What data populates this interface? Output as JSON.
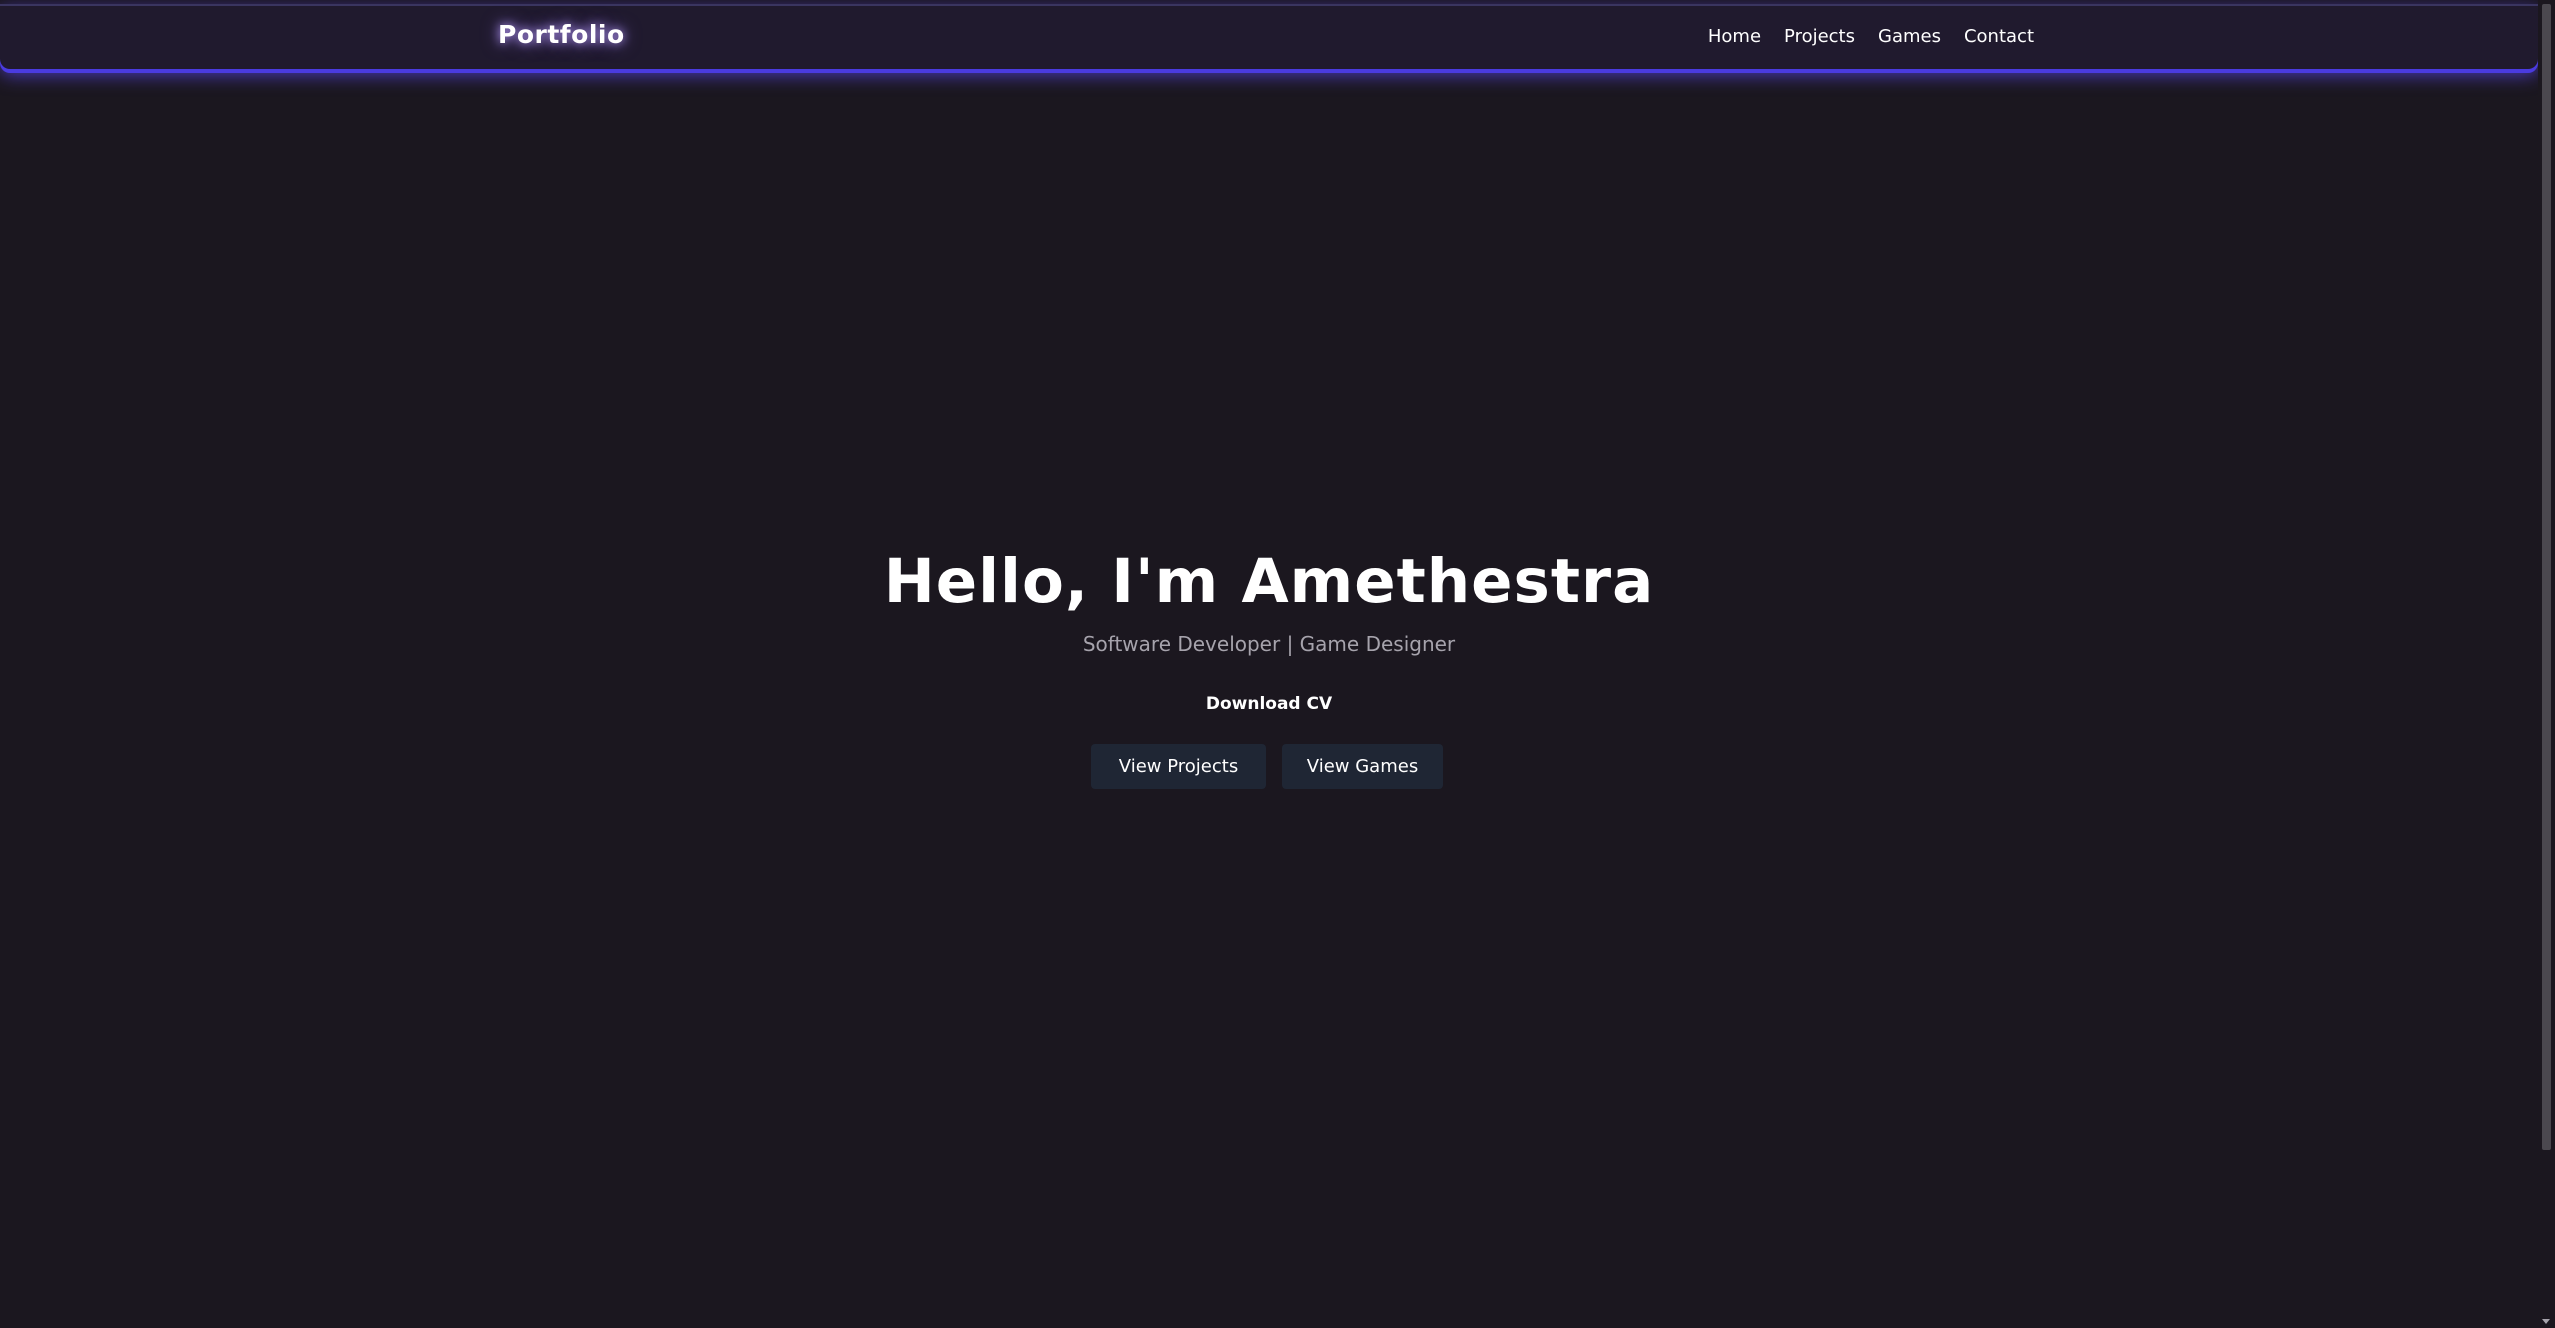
{
  "navbar": {
    "brand": "Portfolio",
    "links": [
      "Home",
      "Projects",
      "Games",
      "Contact"
    ]
  },
  "hero": {
    "title": "Hello, I'm Amethestra",
    "subtitle": "Software Developer | Game Designer",
    "download_label": "Download CV",
    "buttons": [
      "View Projects",
      "View Games"
    ]
  },
  "colors": {
    "background": "#1b171f",
    "navbar": "#201a2e",
    "accent_glow": "#4a3be0",
    "button": "#1f2634",
    "subtitle": "#a6a3ac"
  }
}
